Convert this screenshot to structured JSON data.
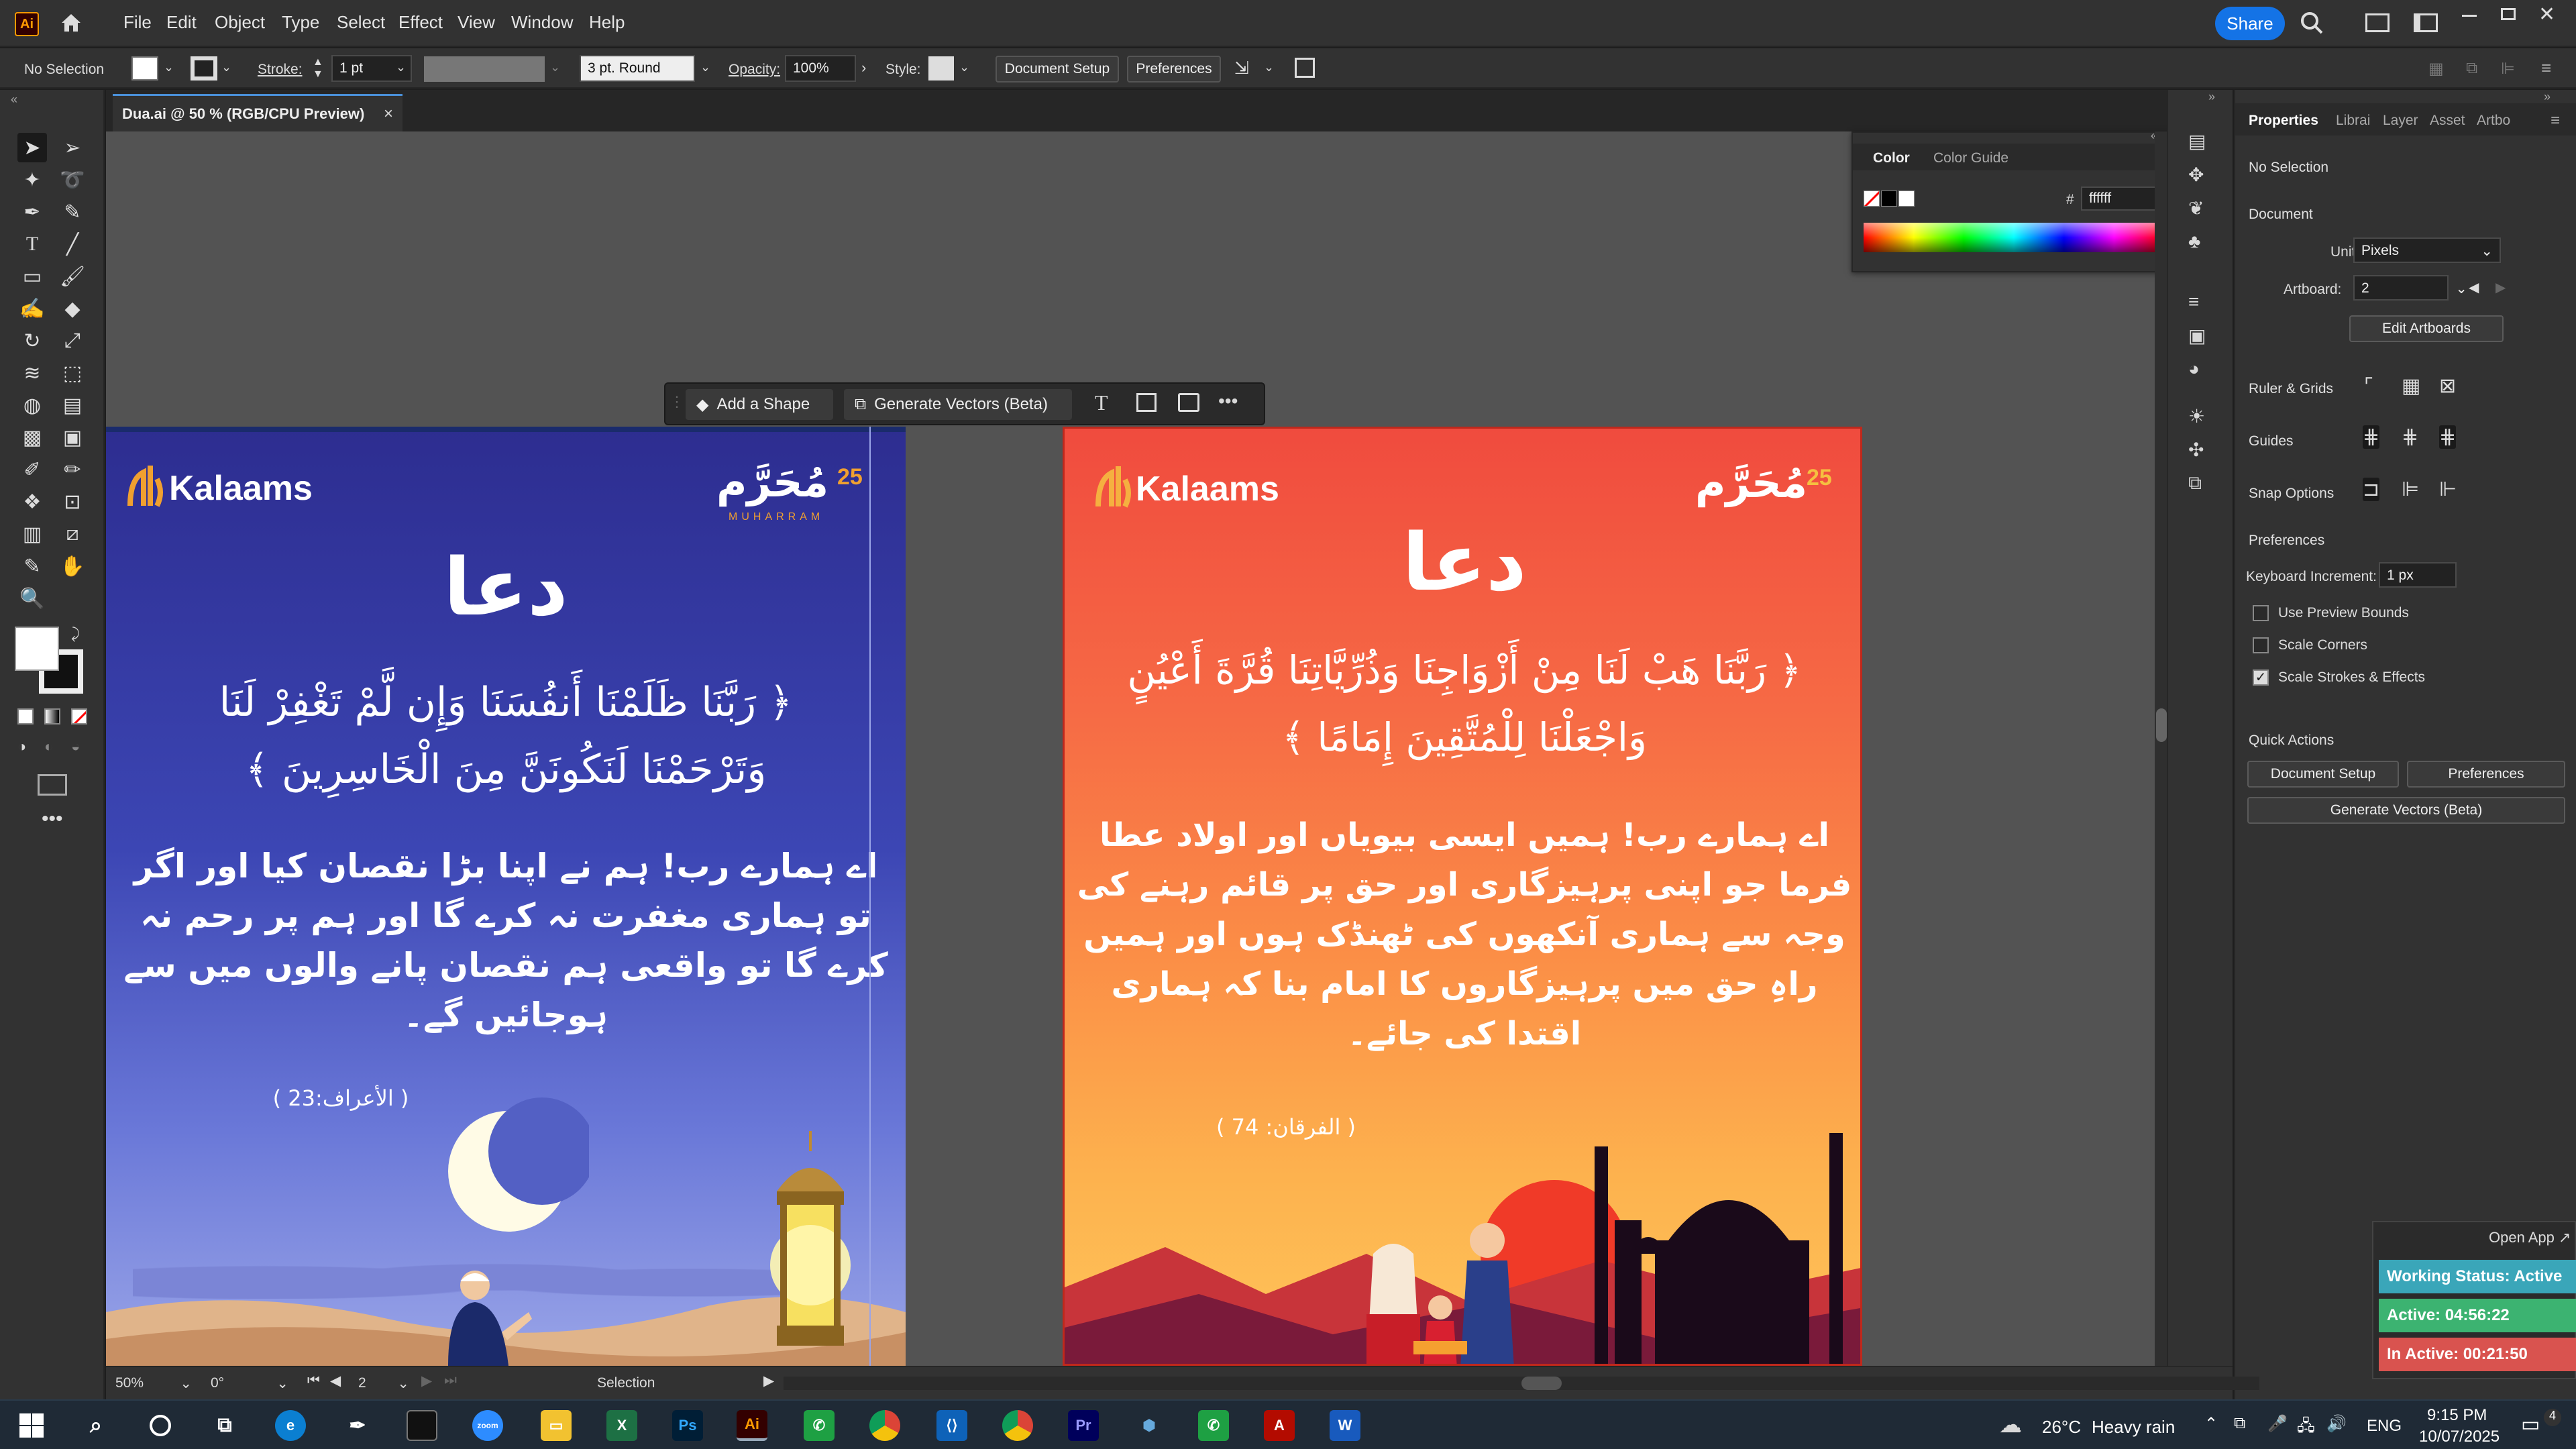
{
  "app": {
    "logo": "Ai",
    "menu": [
      "File",
      "Edit",
      "Object",
      "Type",
      "Select",
      "Effect",
      "View",
      "Window",
      "Help"
    ],
    "share_label": "Share"
  },
  "control": {
    "selection": "No Selection",
    "stroke_label": "Stroke:",
    "stroke_value": "1 pt",
    "brush": "3 pt. Round",
    "opacity_label": "Opacity:",
    "opacity_value": "100%",
    "style_label": "Style:",
    "doc_setup": "Document Setup",
    "preferences": "Preferences"
  },
  "tab": {
    "title": "Dua.ai @ 50 % (RGB/CPU Preview)",
    "close": "×"
  },
  "color_panel": {
    "tab1": "Color",
    "tab2": "Color Guide",
    "hash": "#",
    "hex": "ffffff"
  },
  "context_bar": {
    "add_shape": "Add a Shape",
    "generate_vectors": "Generate Vectors (Beta)"
  },
  "artboard1": {
    "brand": "Kalaams",
    "badge_num": "25",
    "badge_ar": "مُحَرَّم",
    "badge_sub": "MUHARRAM",
    "title": "دعا",
    "arabic1": "﴿ رَبَّنَا ظَلَمْنَا أَنفُسَنَا وَإِن لَّمْ تَغْفِرْ لَنَا",
    "arabic2": "وَتَرْحَمْنَا لَنَكُونَنَّ مِنَ الْخَاسِرِينَ ﴾",
    "urdu": [
      "اے ہمارے رب! ہم نے اپنا بڑا نقصان کیا اور اگر",
      "تو ہماری مغفرت نہ کرے گا اور ہم پر رحم نہ",
      "کرے گا تو واقعی ہم نقصان پانے والوں میں سے",
      "ہوجائیں گے۔"
    ],
    "ref": "( الأعراف:23 )"
  },
  "artboard2": {
    "brand": "Kalaams",
    "badge_num": "25",
    "badge_ar": "مُحَرَّم",
    "title": "دعا",
    "arabic1": "﴿ رَبَّنَا هَبْ لَنَا مِنْ أَزْوَاجِنَا وَذُرِّيَّاتِنَا قُرَّةَ أَعْيُنٍ",
    "arabic2": "وَاجْعَلْنَا لِلْمُتَّقِينَ إِمَامًا ﴾",
    "urdu": [
      "اے ہمارے رب! ہمیں ایسی بیویاں اور اولاد عطا",
      "فرما جو اپنی پرہیزگاری اور حق پر قائم رہنے کی",
      "وجہ سے ہماری آنکھوں کی ٹھنڈک ہوں اور ہمیں",
      "راہِ حق میں پرہیزگاروں کا امام بنا کہ ہماری",
      "اقتدا کی جائے۔"
    ],
    "ref": "( الفرقان: 74 )"
  },
  "status": {
    "zoom": "50%",
    "rotate": "0°",
    "artboard_num": "2",
    "tool": "Selection"
  },
  "props": {
    "tabs": [
      "Properties",
      "Librai",
      "Layer",
      "Asset",
      "Artbo"
    ],
    "no_selection": "No Selection",
    "document": "Document",
    "units_label": "Units:",
    "units_value": "Pixels",
    "artboard_label": "Artboard:",
    "artboard_value": "2",
    "edit_artboards": "Edit Artboards",
    "ruler": "Ruler & Grids",
    "guides": "Guides",
    "snap": "Snap Options",
    "preferences": "Preferences",
    "kb_label": "Keyboard Increment:",
    "kb_value": "1 px",
    "use_preview": "Use Preview Bounds",
    "scale_corners": "Scale Corners",
    "scale_strokes": "Scale Strokes & Effects",
    "quick_actions": "Quick Actions",
    "qa_doc_setup": "Document Setup",
    "qa_prefs": "Preferences",
    "qa_genvec": "Generate Vectors (Beta)"
  },
  "widget": {
    "open_app": "Open App ↗",
    "working": "Working Status: Active",
    "active": "Active: 04:56:22",
    "inactive": "In Active: 00:21:50"
  },
  "taskbar": {
    "weather_temp": "26°C",
    "weather_desc": "Heavy rain",
    "lang": "ENG",
    "time": "9:15 PM",
    "date": "10/07/2025",
    "notif": "4"
  },
  "colors": {
    "accent_blue": "#1473e6",
    "ai_orange": "#ff9a00",
    "working_teal": "#3aa6b9",
    "active_green": "#3cb371",
    "inactive_red": "#d9534f"
  }
}
